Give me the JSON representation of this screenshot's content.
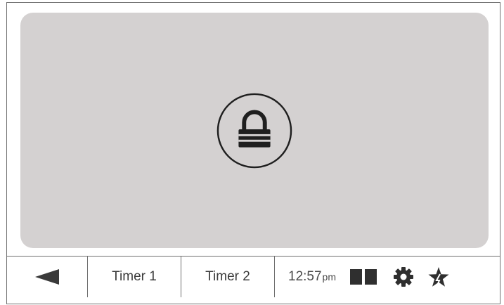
{
  "screen": {
    "lock_icon": "lock-icon",
    "panel_color": "#d4d1d1"
  },
  "bottom_bar": {
    "back_icon": "back-arrow-icon",
    "timer1_label": "Timer 1",
    "timer2_label": "Timer 2",
    "time": "12:57",
    "time_suffix": "pm",
    "split_icon": "split-view-icon",
    "settings_icon": "gear-icon",
    "favorite_icon": "star-icon"
  },
  "colors": {
    "icon": "#2a2a2a",
    "text": "#3b3b3b",
    "border": "#6f6f6f"
  }
}
